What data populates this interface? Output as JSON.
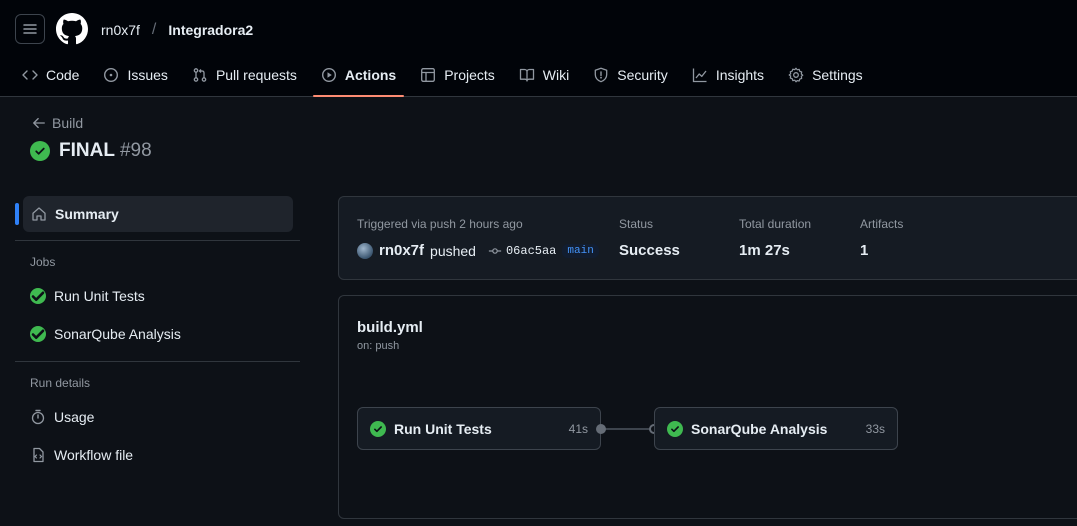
{
  "header": {
    "owner": "rn0x7f",
    "separator": "/",
    "repo": "Integradora2"
  },
  "nav": [
    {
      "label": "Code",
      "icon": "code-icon"
    },
    {
      "label": "Issues",
      "icon": "issue-icon"
    },
    {
      "label": "Pull requests",
      "icon": "pull-request-icon"
    },
    {
      "label": "Actions",
      "icon": "play-icon",
      "active": true
    },
    {
      "label": "Projects",
      "icon": "table-icon"
    },
    {
      "label": "Wiki",
      "icon": "book-icon"
    },
    {
      "label": "Security",
      "icon": "shield-icon"
    },
    {
      "label": "Insights",
      "icon": "graph-icon"
    },
    {
      "label": "Settings",
      "icon": "gear-icon"
    }
  ],
  "run": {
    "back_label": "Build",
    "title": "FINAL",
    "number": "#98"
  },
  "sidebar": {
    "summary_label": "Summary",
    "jobs_heading": "Jobs",
    "jobs": [
      "Run Unit Tests",
      "SonarQube Analysis"
    ],
    "details_heading": "Run details",
    "details": [
      {
        "label": "Usage",
        "icon": "stopwatch-icon"
      },
      {
        "label": "Workflow file",
        "icon": "file-code-icon"
      }
    ]
  },
  "summary": {
    "trigger_label": "Triggered via push 2 hours ago",
    "actor": "rn0x7f",
    "action": "pushed",
    "sha": "06ac5aa",
    "branch": "main",
    "status_label": "Status",
    "status_value": "Success",
    "duration_label": "Total duration",
    "duration_value": "1m 27s",
    "artifacts_label": "Artifacts",
    "artifacts_value": "1"
  },
  "workflow": {
    "file": "build.yml",
    "on": "on: push",
    "jobs": [
      {
        "name": "Run Unit Tests",
        "duration": "41s"
      },
      {
        "name": "SonarQube Analysis",
        "duration": "33s"
      }
    ]
  },
  "colors": {
    "success": "#3fb950",
    "accent": "#2f81f7",
    "active_tab": "#fd8c73"
  }
}
